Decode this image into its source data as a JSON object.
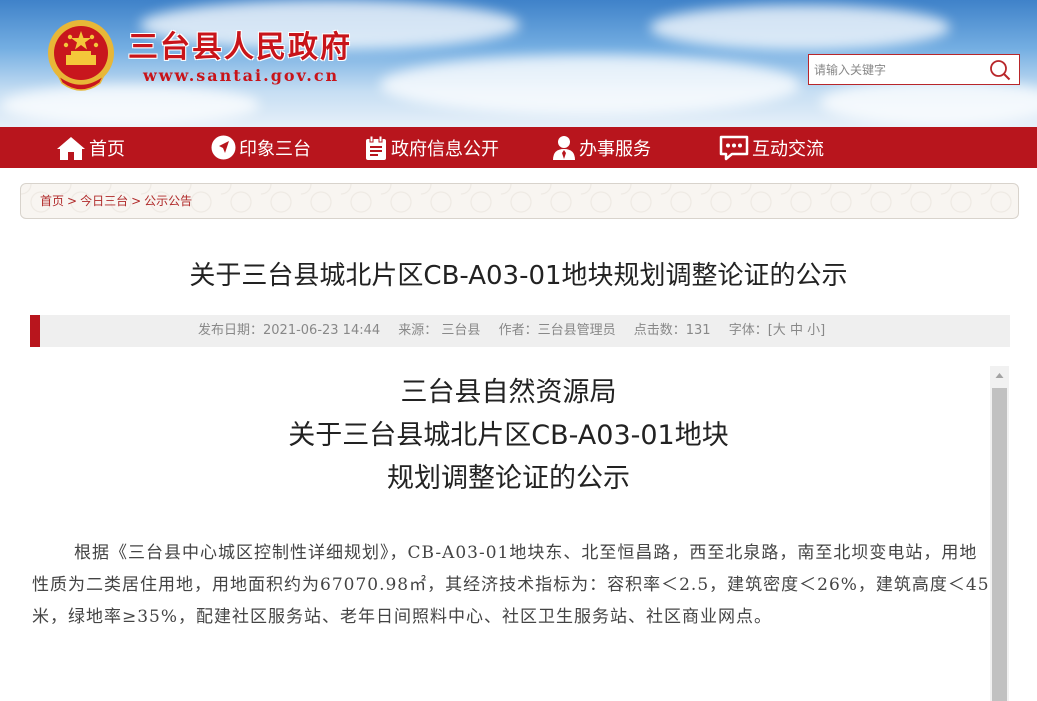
{
  "header": {
    "site_title": "三台县人民政府",
    "site_domain": "www.santai.gov.cn",
    "search_placeholder": "请输入关键字"
  },
  "nav": {
    "items": [
      {
        "label": "首页",
        "icon": "home-icon"
      },
      {
        "label": "印象三台",
        "icon": "navigation-icon"
      },
      {
        "label": "政府信息公开",
        "icon": "document-icon"
      },
      {
        "label": "办事服务",
        "icon": "user-icon"
      },
      {
        "label": "互动交流",
        "icon": "chat-icon"
      }
    ]
  },
  "breadcrumb": {
    "items": [
      "首页",
      "今日三台",
      "公示公告"
    ],
    "separator": ">"
  },
  "article": {
    "title": "关于三台县城北片区CB-A03-01地块规划调整论证的公示",
    "meta": {
      "date": "发布日期：2021-06-23 14:44",
      "source": "来源：  三台县",
      "author": "作者：三台县管理员",
      "hits": "点击数：131",
      "font_label": "字体：[",
      "font_large": "大",
      "font_medium": "中",
      "font_small": "小",
      "font_close": "]"
    },
    "heading_lines": [
      "三台县自然资源局",
      "关于三台县城北片区CB-A03-01地块",
      "规划调整论证的公示"
    ],
    "paragraph": "根据《三台县中心城区控制性详细规划》，CB-A03-01地块东、北至恒昌路，西至北泉路，南至北坝变电站，用地性质为二类居住用地，用地面积约为67070.98㎡，其经济技术指标为：容积率＜2.5，建筑密度＜26%，建筑高度＜45米，绿地率≥35%，配建社区服务站、老年日间照料中心、社区卫生服务站、社区商业网点。"
  },
  "colors": {
    "brand_red": "#b8151d",
    "title_red": "#c8141a"
  }
}
